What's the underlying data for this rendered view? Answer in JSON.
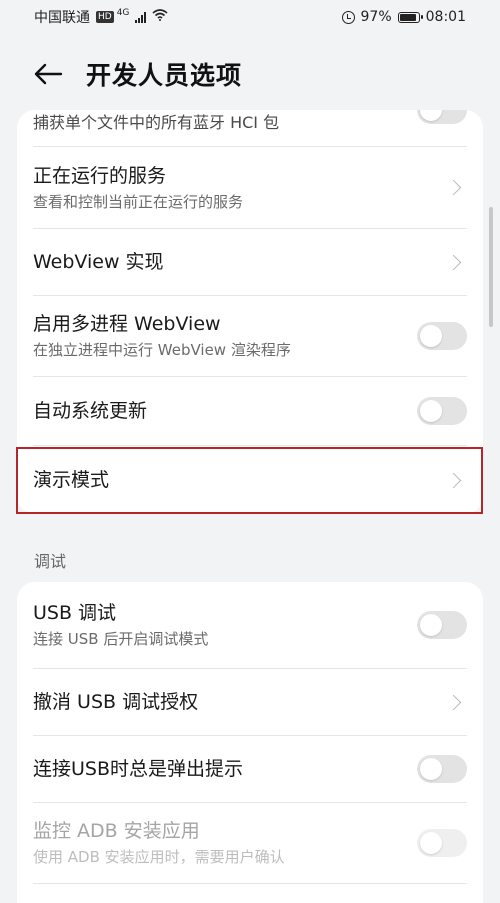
{
  "status_bar": {
    "carrier": "中国联通",
    "hd": "HD",
    "network": "4G",
    "battery_percent": "97%",
    "battery_level": 0.97,
    "time": "08:01"
  },
  "header": {
    "title": "开发人员选项"
  },
  "card1": {
    "partial_item_sub": "捕获单个文件中的所有蓝牙 HCI 包",
    "items": [
      {
        "title": "正在运行的服务",
        "sub": "查看和控制当前正在运行的服务",
        "control": "chevron"
      },
      {
        "title": "WebView 实现",
        "control": "chevron"
      },
      {
        "title": "启用多进程 WebView",
        "sub": "在独立进程中运行 WebView 渲染程序",
        "control": "toggle",
        "on": false
      },
      {
        "title": "自动系统更新",
        "control": "toggle",
        "on": false
      },
      {
        "title": "演示模式",
        "control": "chevron"
      }
    ]
  },
  "debug_section": {
    "label": "调试",
    "items": [
      {
        "title": "USB 调试",
        "sub": "连接 USB 后开启调试模式",
        "control": "toggle",
        "on": false
      },
      {
        "title": "撤消 USB 调试授权",
        "control": "chevron"
      },
      {
        "title": "连接USB时总是弹出提示",
        "control": "toggle",
        "on": false
      },
      {
        "title": "监控 ADB 安装应用",
        "sub": "使用 ADB 安装应用时，需要用户确认",
        "control": "toggle",
        "on": false,
        "disabled": true
      }
    ]
  },
  "colors": {
    "background": "#f1f3f5",
    "card": "#ffffff",
    "highlight": "#b3262b",
    "toggle_off": "#e3e3e3"
  }
}
